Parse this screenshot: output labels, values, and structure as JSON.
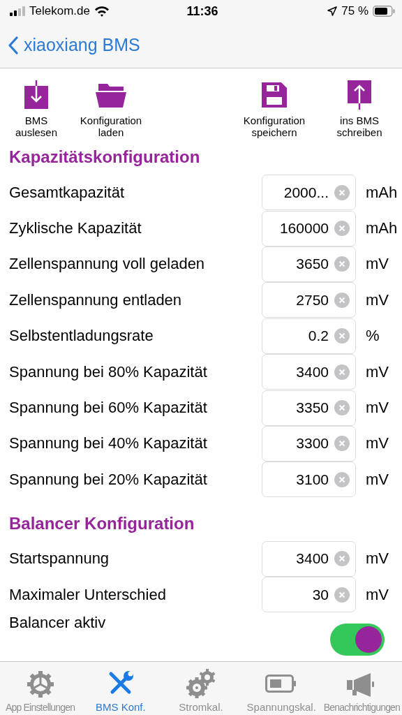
{
  "status_bar": {
    "carrier": "Telekom.de",
    "time": "11:36",
    "battery": "75 %"
  },
  "nav": {
    "back_label": "xiaoxiang BMS"
  },
  "toolbar": {
    "left": [
      {
        "kind": "download",
        "label": "BMS auslesen"
      },
      {
        "kind": "folder",
        "label": "Konfiguration laden"
      }
    ],
    "right": [
      {
        "kind": "save",
        "label": "Konfiguration speichern"
      },
      {
        "kind": "upload",
        "label": "ins BMS schreiben"
      }
    ]
  },
  "sections": [
    {
      "title": "Kapazitätskonfiguration",
      "rows": [
        {
          "kind": "field",
          "label": "Gesamtkapazität",
          "value": "2000...",
          "unit": "mAh"
        },
        {
          "kind": "field",
          "label": "Zyklische Kapazität",
          "value": "160000",
          "unit": "mAh"
        },
        {
          "kind": "field",
          "label": "Zellenspannung voll geladen",
          "value": "3650",
          "unit": "mV"
        },
        {
          "kind": "field",
          "label": "Zellenspannung entladen",
          "value": "2750",
          "unit": "mV"
        },
        {
          "kind": "field",
          "label": "Selbstentladungsrate",
          "value": "0.2",
          "unit": "%"
        },
        {
          "kind": "field",
          "label": "Spannung bei 80% Kapazität",
          "value": "3400",
          "unit": "mV"
        },
        {
          "kind": "field",
          "label": "Spannung bei 60% Kapazität",
          "value": "3350",
          "unit": "mV"
        },
        {
          "kind": "field",
          "label": "Spannung bei 40% Kapazität",
          "value": "3300",
          "unit": "mV"
        },
        {
          "kind": "field",
          "label": "Spannung bei 20% Kapazität",
          "value": "3100",
          "unit": "mV"
        }
      ]
    },
    {
      "title": "Balancer Konfiguration",
      "rows": [
        {
          "kind": "field",
          "label": "Startspannung",
          "value": "3400",
          "unit": "mV"
        },
        {
          "kind": "field",
          "label": "Maximaler Unterschied",
          "value": "30",
          "unit": "mV"
        },
        {
          "kind": "toggle",
          "label": "Balancer aktiv",
          "on": true
        }
      ]
    }
  ],
  "tabs": [
    {
      "kind": "gear",
      "label": "App Einstellungen",
      "selected": false
    },
    {
      "kind": "tools",
      "label": "BMS Konf.",
      "selected": true
    },
    {
      "kind": "gears",
      "label": "Stromkal.",
      "selected": false
    },
    {
      "kind": "battery",
      "label": "Spannungskal.",
      "selected": false
    },
    {
      "kind": "megaphone",
      "label": "Benachrichtigungen",
      "selected": false
    }
  ]
}
